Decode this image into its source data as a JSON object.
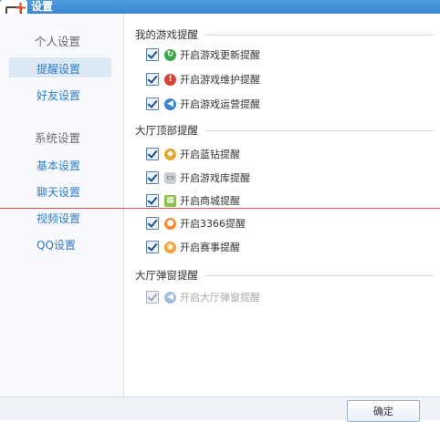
{
  "window": {
    "title": "设置"
  },
  "sidebar": {
    "groups": [
      {
        "title": "个人设置",
        "items": [
          "提醒设置",
          "好友设置"
        ]
      },
      {
        "title": "系统设置",
        "items": [
          "基本设置",
          "聊天设置",
          "视频设置",
          "QQ设置"
        ]
      }
    ],
    "active_item": "提醒设置"
  },
  "sections": [
    {
      "title": "我的游戏提醒",
      "options": [
        {
          "label": "开启游戏更新提醒",
          "checked": true,
          "icon": "green-refresh-icon"
        },
        {
          "label": "开启游戏维护提醒",
          "checked": true,
          "icon": "red-alert-icon"
        },
        {
          "label": "开启游戏运营提醒",
          "checked": true,
          "icon": "blue-speaker-icon"
        }
      ]
    },
    {
      "title": "大厅顶部提醒",
      "options": [
        {
          "label": "开启蓝钻提醒",
          "checked": true,
          "icon": "blue-diamond-icon"
        },
        {
          "label": "开启游戏库提醒",
          "checked": true,
          "icon": "gamepad-icon"
        },
        {
          "label": "开启商城提醒",
          "checked": true,
          "icon": "shop-icon"
        },
        {
          "label": "开启3366提醒",
          "checked": true,
          "icon": "3366-icon"
        },
        {
          "label": "开启赛事提醒",
          "checked": true,
          "icon": "trophy-icon"
        }
      ]
    },
    {
      "title": "大厅弹窗提醒",
      "options": [
        {
          "label": "开启大厅弹窗提醒",
          "checked": true,
          "disabled": true,
          "icon": "blue-speaker-icon"
        }
      ]
    }
  ],
  "buttons": {
    "ok": "确定"
  }
}
